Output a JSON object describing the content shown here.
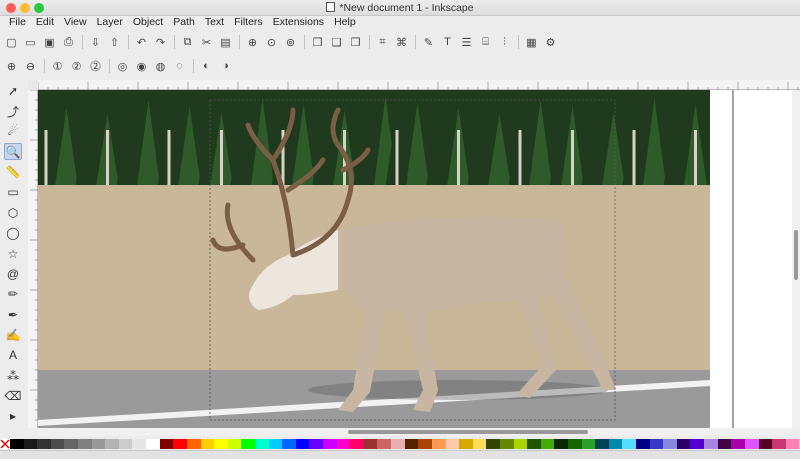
{
  "window": {
    "title": "*New document 1 - Inkscape",
    "traffic_colors": [
      "#fe5f57",
      "#febc2e",
      "#28c840"
    ]
  },
  "menu": [
    "File",
    "Edit",
    "View",
    "Layer",
    "Object",
    "Path",
    "Text",
    "Filters",
    "Extensions",
    "Help"
  ],
  "commands_bar": [
    {
      "name": "new-icon",
      "glyph": "▢"
    },
    {
      "name": "open-icon",
      "glyph": "▭"
    },
    {
      "name": "save-icon",
      "glyph": "▣"
    },
    {
      "name": "print-icon",
      "glyph": "⎙"
    },
    {
      "sep": true
    },
    {
      "name": "import-icon",
      "glyph": "⇩"
    },
    {
      "name": "export-icon",
      "glyph": "⇧"
    },
    {
      "sep": true
    },
    {
      "name": "undo-icon",
      "glyph": "↶"
    },
    {
      "name": "redo-icon",
      "glyph": "↷"
    },
    {
      "sep": true
    },
    {
      "name": "copy-icon",
      "glyph": "⧉"
    },
    {
      "name": "cut-icon",
      "glyph": "✂"
    },
    {
      "name": "paste-icon",
      "glyph": "▤"
    },
    {
      "sep": true
    },
    {
      "name": "zoom-selection-icon",
      "glyph": "⊕"
    },
    {
      "name": "zoom-drawing-icon",
      "glyph": "⊙"
    },
    {
      "name": "zoom-page-icon",
      "glyph": "⊚"
    },
    {
      "sep": true
    },
    {
      "name": "duplicate-icon",
      "glyph": "❐"
    },
    {
      "name": "clone-icon",
      "glyph": "❑"
    },
    {
      "name": "unlink-clone-icon",
      "glyph": "❒"
    },
    {
      "sep": true
    },
    {
      "name": "group-icon",
      "glyph": "⌗"
    },
    {
      "name": "ungroup-icon",
      "glyph": "⌘"
    },
    {
      "sep": true
    },
    {
      "name": "fill-stroke-icon",
      "glyph": "✎"
    },
    {
      "name": "text-font-icon",
      "glyph": "T"
    },
    {
      "name": "layers-icon",
      "glyph": "☰"
    },
    {
      "name": "xml-editor-icon",
      "glyph": "⌸"
    },
    {
      "name": "align-icon",
      "glyph": "⫶"
    },
    {
      "sep": true
    },
    {
      "name": "document-properties-icon",
      "glyph": "▦"
    },
    {
      "name": "preferences-icon",
      "glyph": "⚙"
    }
  ],
  "tool_controls": [
    {
      "name": "zoom-in-icon",
      "glyph": "⊕"
    },
    {
      "name": "zoom-out-icon",
      "glyph": "⊖"
    },
    {
      "sep": true
    },
    {
      "name": "zoom-1to1-icon",
      "glyph": "①"
    },
    {
      "name": "zoom-1to2-icon",
      "glyph": "②"
    },
    {
      "name": "zoom-2to1-icon",
      "glyph": "⓶"
    },
    {
      "sep": true
    },
    {
      "name": "zoom-selection-tc-icon",
      "glyph": "◎"
    },
    {
      "name": "zoom-drawing-tc-icon",
      "glyph": "◉"
    },
    {
      "name": "zoom-page-tc-icon",
      "glyph": "◍"
    },
    {
      "name": "zoom-width-tc-icon",
      "glyph": "◌"
    },
    {
      "sep": true
    },
    {
      "name": "zoom-prev-icon",
      "glyph": "◐"
    },
    {
      "name": "zoom-next-icon",
      "glyph": "◑"
    }
  ],
  "toolbox": [
    {
      "name": "selector-tool-icon",
      "glyph": "➚",
      "active": false
    },
    {
      "name": "node-tool-icon",
      "glyph": "⤴",
      "active": false
    },
    {
      "name": "tweak-tool-icon",
      "glyph": "☄",
      "active": false
    },
    {
      "name": "zoom-tool-icon",
      "glyph": "🔍",
      "active": true
    },
    {
      "name": "measure-tool-icon",
      "glyph": "📏",
      "active": false
    },
    {
      "name": "rectangle-tool-icon",
      "glyph": "▭",
      "active": false
    },
    {
      "name": "3d-box-tool-icon",
      "glyph": "⬡",
      "active": false
    },
    {
      "name": "ellipse-tool-icon",
      "glyph": "◯",
      "active": false
    },
    {
      "name": "star-tool-icon",
      "glyph": "☆",
      "active": false
    },
    {
      "name": "spiral-tool-icon",
      "glyph": "@",
      "active": false
    },
    {
      "name": "pencil-tool-icon",
      "glyph": "✏",
      "active": false
    },
    {
      "name": "pen-tool-icon",
      "glyph": "✒",
      "active": false
    },
    {
      "name": "calligraphy-tool-icon",
      "glyph": "✍",
      "active": false
    },
    {
      "name": "text-tool-icon",
      "glyph": "A",
      "active": false
    },
    {
      "name": "spray-tool-icon",
      "glyph": "⁂",
      "active": false
    },
    {
      "name": "eraser-tool-icon",
      "glyph": "⌫",
      "active": false
    },
    {
      "name": "more-tools-icon",
      "glyph": "▸",
      "active": false
    }
  ],
  "palette_colors": [
    "#000000",
    "#1a1a1a",
    "#333333",
    "#4d4d4d",
    "#666666",
    "#808080",
    "#999999",
    "#b3b3b3",
    "#cccccc",
    "#e6e6e6",
    "#ffffff",
    "#800000",
    "#ff0000",
    "#ff6600",
    "#ffcc00",
    "#ffff00",
    "#ccff00",
    "#00ff00",
    "#00ffcc",
    "#00ccff",
    "#0066ff",
    "#0000ff",
    "#6600ff",
    "#cc00ff",
    "#ff00cc",
    "#ff0066",
    "#993333",
    "#cc6666",
    "#e9afaf",
    "#552200",
    "#aa4400",
    "#ff9955",
    "#ffccaa",
    "#d4aa00",
    "#ffdd55",
    "#334400",
    "#668800",
    "#aad400",
    "#225500",
    "#44aa00",
    "#0b2800",
    "#166600",
    "#2ca02c",
    "#004455",
    "#0088aa",
    "#55ddff",
    "#000080",
    "#3737c8",
    "#8787de",
    "#2b0066",
    "#5500d4",
    "#aa87de",
    "#440044",
    "#aa00aa",
    "#dd55ff",
    "#550022",
    "#c83771",
    "#ff80b2"
  ],
  "scene": {
    "sky": "#cfe0ee",
    "forest_dark": "#1f3a1d",
    "forest_mid": "#2f5a2a",
    "gravel": "#c9b79a",
    "road": "#9a9a9a",
    "road_line": "#f2f2f2",
    "reindeer_body": "#c7b7a2",
    "reindeer_neck": "#ece6dc",
    "antler": "#7a5e45"
  }
}
